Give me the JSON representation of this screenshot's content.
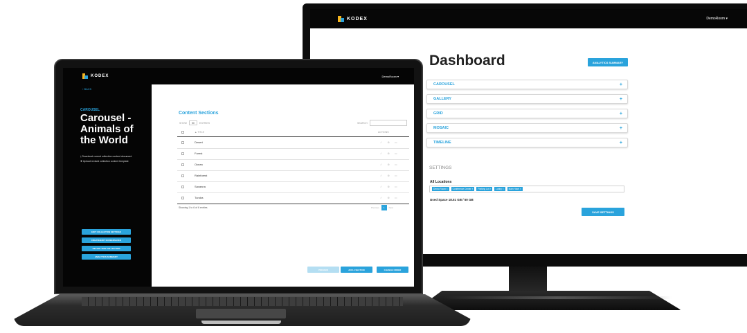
{
  "monitor": {
    "brand": "KODEX",
    "user_menu": "DemoRoom ▾",
    "title": "Dashboard",
    "analytics_button": "ANALYTICS SUMMARY",
    "sections": [
      "CAROUSEL",
      "GALLERY",
      "GRID",
      "MOSAIC",
      "TIMELINE"
    ],
    "plus_icon": "+",
    "settings_heading": "SETTINGS",
    "locations_heading": "All Locations",
    "location_tags": [
      "Demo Room ×",
      "Conference Center ×",
      "Parking Lot ×",
      "Lobby ×",
      "Main Hotel ×"
    ],
    "used_space": "Used Space 18.51 GB / 50 GB",
    "save_settings": "SAVE SETTINGS"
  },
  "laptop": {
    "brand": "KODEX",
    "user_menu": "DemoRoom ▾",
    "back": "‹ BACK",
    "kicker": "CAROUSEL",
    "title": "Carousel - Animals of the World",
    "side_links": [
      "Download current collection content document",
      "Upload revised collection content template"
    ],
    "side_buttons": [
      "EDIT COLLECTION SETTINGS",
      "CREATE/EDIT SCREENSAVER",
      "DELETE THIS COLLECTION",
      "ANALYTICS SUMMARY"
    ],
    "content_title": "Content Sections",
    "show_label": "SHOW",
    "show_value": "50",
    "entries_label": "ENTRIES",
    "search_label": "SEARCH:",
    "col_title": "▲ TITLE",
    "col_actions": "ACTIONS",
    "rows": [
      "Desert",
      "Forest",
      "Ocean",
      "Rainforest",
      "Savanna",
      "Tundra"
    ],
    "row_actions": "✓ ⊗ ▭",
    "showing": "Showing 1 to 6 of 6 entries",
    "prev": "Previous",
    "page": "1",
    "next": "Next",
    "bottom_buttons": [
      "PREVIEW",
      "ADD A SECTION",
      "CHANGE ORDER"
    ]
  },
  "colors": {
    "accent": "#2aa3dc",
    "logo_yellow": "#f6b51e",
    "dark": "#050505"
  }
}
